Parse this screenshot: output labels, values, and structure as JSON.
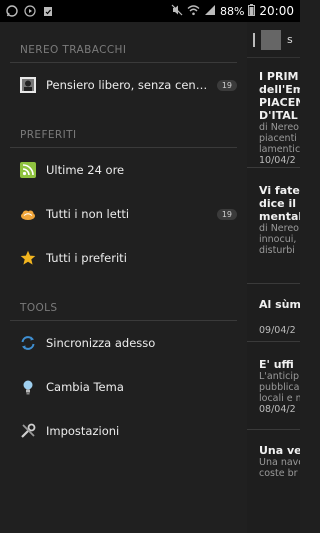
{
  "status_bar": {
    "notifications": [
      "whatsapp-icon",
      "play-icon",
      "clipboard-icon"
    ],
    "battery": "88%",
    "time": "20:00"
  },
  "drawer": {
    "sections": [
      {
        "header": "NEREO TRABACCHI",
        "items": [
          {
            "icon": "avatar-icon",
            "label": "Pensiero libero, senza censure...",
            "count": "19"
          }
        ]
      },
      {
        "header": "PREFERITI",
        "items": [
          {
            "icon": "rss-icon",
            "label": "Ultime 24 ore",
            "count": ""
          },
          {
            "icon": "cloud-icon",
            "label": "Tutti i non letti",
            "count": "19"
          },
          {
            "icon": "star-icon",
            "label": "Tutti i preferiti",
            "count": ""
          }
        ]
      },
      {
        "header": "TOOLS",
        "items": [
          {
            "icon": "sync-icon",
            "label": "Sincronizza adesso",
            "count": ""
          },
          {
            "icon": "bulb-icon",
            "label": "Cambia Tema",
            "count": ""
          },
          {
            "icon": "settings-icon",
            "label": "Impostazioni",
            "count": ""
          }
        ]
      }
    ]
  },
  "content": {
    "header_title": "s",
    "articles": [
      {
        "title": [
          "I PRIM",
          "dell'Em",
          "PIACEN",
          "D'ITAL"
        ],
        "excerpt": [
          "di Nereo",
          "piacenti",
          "lamentic"
        ],
        "date": "10/04/2"
      },
      {
        "title": [
          "Vi fate",
          "dice il l",
          "mentale"
        ],
        "excerpt": [
          "di Nereo",
          "innocui,",
          "disturbi"
        ],
        "date": "10/04/2"
      },
      {
        "title": [
          "Al sùm"
        ],
        "excerpt": [],
        "date": "09/04/2"
      },
      {
        "title": [
          "E' uffi"
        ],
        "excerpt": [
          "L'anticip",
          "pubblica",
          "locali e m"
        ],
        "date": "08/04/2"
      },
      {
        "title": [
          "Una ver"
        ],
        "excerpt": [
          "Una nave",
          "coste br"
        ],
        "date": ""
      }
    ]
  }
}
